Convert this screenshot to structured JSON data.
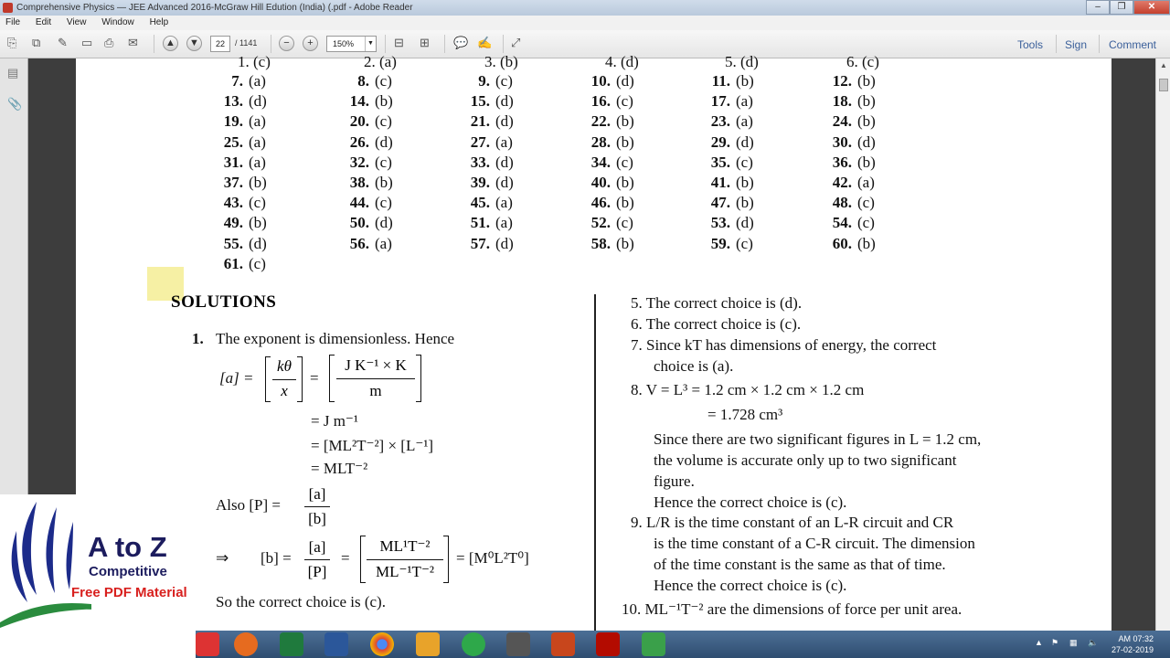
{
  "window": {
    "title": "Comprehensive Physics — JEE Advanced 2016-McGraw Hill Edution (India) (.pdf - Adobe Reader"
  },
  "menu": [
    "File",
    "Edit",
    "View",
    "Window",
    "Help"
  ],
  "toolbar": {
    "page_current": "22",
    "page_total": "/ 1141",
    "zoom": "150%",
    "tools_label": "Tools",
    "sign_label": "Sign",
    "comment_label": "Comment"
  },
  "answers": {
    "top_partial": [
      "1. (c)",
      "2. (a)",
      "3. (b)",
      "4. (d)",
      "5. (d)",
      "6. (c)"
    ],
    "rows": [
      [
        [
          "7.",
          "(a)"
        ],
        [
          "8.",
          "(c)"
        ],
        [
          "9.",
          "(c)"
        ],
        [
          "10.",
          "(d)"
        ],
        [
          "11.",
          "(b)"
        ],
        [
          "12.",
          "(b)"
        ]
      ],
      [
        [
          "13.",
          "(d)"
        ],
        [
          "14.",
          "(b)"
        ],
        [
          "15.",
          "(d)"
        ],
        [
          "16.",
          "(c)"
        ],
        [
          "17.",
          "(a)"
        ],
        [
          "18.",
          "(b)"
        ]
      ],
      [
        [
          "19.",
          "(a)"
        ],
        [
          "20.",
          "(c)"
        ],
        [
          "21.",
          "(d)"
        ],
        [
          "22.",
          "(b)"
        ],
        [
          "23.",
          "(a)"
        ],
        [
          "24.",
          "(b)"
        ]
      ],
      [
        [
          "25.",
          "(a)"
        ],
        [
          "26.",
          "(d)"
        ],
        [
          "27.",
          "(a)"
        ],
        [
          "28.",
          "(b)"
        ],
        [
          "29.",
          "(d)"
        ],
        [
          "30.",
          "(d)"
        ]
      ],
      [
        [
          "31.",
          "(a)"
        ],
        [
          "32.",
          "(c)"
        ],
        [
          "33.",
          "(d)"
        ],
        [
          "34.",
          "(c)"
        ],
        [
          "35.",
          "(c)"
        ],
        [
          "36.",
          "(b)"
        ]
      ],
      [
        [
          "37.",
          "(b)"
        ],
        [
          "38.",
          "(b)"
        ],
        [
          "39.",
          "(d)"
        ],
        [
          "40.",
          "(b)"
        ],
        [
          "41.",
          "(b)"
        ],
        [
          "42.",
          "(a)"
        ]
      ],
      [
        [
          "43.",
          "(c)"
        ],
        [
          "44.",
          "(c)"
        ],
        [
          "45.",
          "(a)"
        ],
        [
          "46.",
          "(b)"
        ],
        [
          "47.",
          "(b)"
        ],
        [
          "48.",
          "(c)"
        ]
      ],
      [
        [
          "49.",
          "(b)"
        ],
        [
          "50.",
          "(d)"
        ],
        [
          "51.",
          "(a)"
        ],
        [
          "52.",
          "(c)"
        ],
        [
          "53.",
          "(d)"
        ],
        [
          "54.",
          "(c)"
        ]
      ],
      [
        [
          "55.",
          "(d)"
        ],
        [
          "56.",
          "(a)"
        ],
        [
          "57.",
          "(d)"
        ],
        [
          "58.",
          "(b)"
        ],
        [
          "59.",
          "(c)"
        ],
        [
          "60.",
          "(b)"
        ]
      ],
      [
        [
          "61.",
          "(c)"
        ]
      ]
    ]
  },
  "solutions": {
    "heading": "SOLUTIONS",
    "s1_num": "1.",
    "s1_text": "The exponent is dimensionless. Hence",
    "s1_eq_a": "[a] =",
    "s1_frac1_num": "kθ",
    "s1_frac1_den": "x",
    "s1_frac2_num": "J K⁻¹ × K",
    "s1_frac2_den": "m",
    "s1_line2": "= J m⁻¹",
    "s1_line3": "= [ML²T⁻²] × [L⁻¹]",
    "s1_line4": "= MLT⁻²",
    "s1_also": "Also  [P] =",
    "s1_also_num": "[a]",
    "s1_also_den": "[b]",
    "s1_arrow": "⇒",
    "s1_b_eq": "[b] =",
    "s1_b_num": "[a]",
    "s1_b_den": "[P]",
    "s1_b2_num": "ML¹T⁻²",
    "s1_b2_den": "ML⁻¹T⁻²",
    "s1_b_result": "= [M⁰L²T⁰]",
    "s1_conclusion": "So the correct choice is (c).",
    "s5": "5.  The correct choice is (d).",
    "s6": "6.  The correct choice is (c).",
    "s7_a": "7.  Since kT has dimensions of energy, the correct",
    "s7_b": "choice is (a).",
    "s8_a": "8.  V = L³ = 1.2 cm × 1.2 cm × 1.2 cm",
    "s8_b": "= 1.728 cm³",
    "s8_c": "Since there are two significant figures in L = 1.2 cm,",
    "s8_d": "the volume is accurate only up to two significant",
    "s8_e": "figure.",
    "s8_f": "Hence the correct choice is (c).",
    "s9_a": "9.  L/R is the time constant of an L-R circuit and CR",
    "s9_b": "is the time constant of a C-R circuit. The dimension",
    "s9_c": "of the time constant is the same as that of time.",
    "s9_d": "Hence the correct choice is (c).",
    "s10_a": "10.  ML⁻¹T⁻² are the dimensions of force per unit area."
  },
  "logo": {
    "title": "A to Z",
    "line1": "Competitive",
    "line2": "Free PDF Material"
  },
  "clock": {
    "time": "AM 07:32",
    "date": "27-02-2019"
  }
}
